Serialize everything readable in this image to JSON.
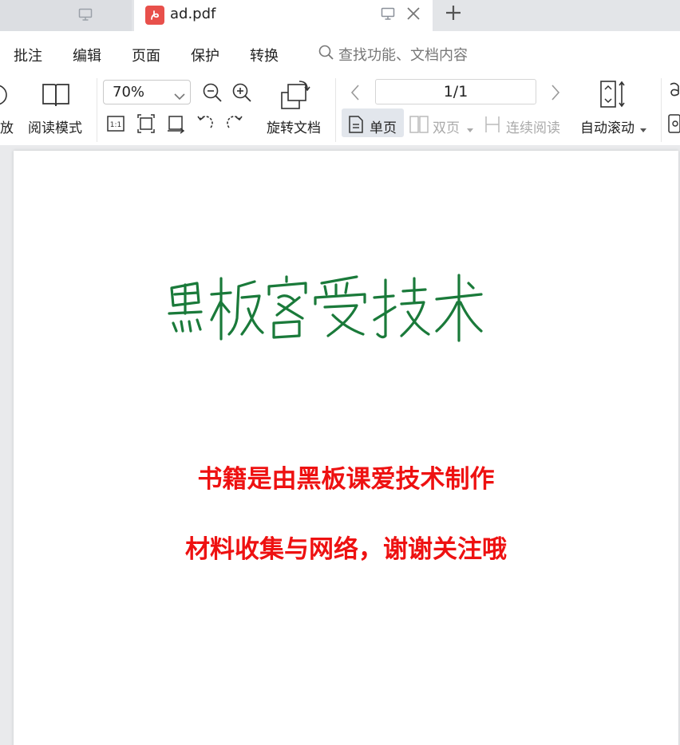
{
  "tabs": {
    "inactive": {
      "icon": "monitor-icon"
    },
    "active": {
      "title": "ad.pdf",
      "icon": "pdf-icon"
    },
    "new_tab_icon": "plus-icon"
  },
  "menu": {
    "items": [
      "批注",
      "编辑",
      "页面",
      "保护",
      "转换"
    ],
    "search_placeholder": "查找功能、文档内容"
  },
  "toolbar": {
    "cut_label": "放",
    "read_mode_label": "阅读模式",
    "zoom_value": "70%",
    "rotate_doc_label": "旋转文档",
    "page_value": "1/1",
    "single_page_label": "单页",
    "double_page_label": "双页",
    "continuous_label": "连续阅读",
    "auto_scroll_label": "自动滚动"
  },
  "document": {
    "logo_text": "黑板客爱技术",
    "line1": "书籍是由黑板课爱技术制作",
    "line2": "材料收集与网络，谢谢关注哦",
    "logo_color": "#1a7a3a",
    "text_color": "#ee1111"
  }
}
